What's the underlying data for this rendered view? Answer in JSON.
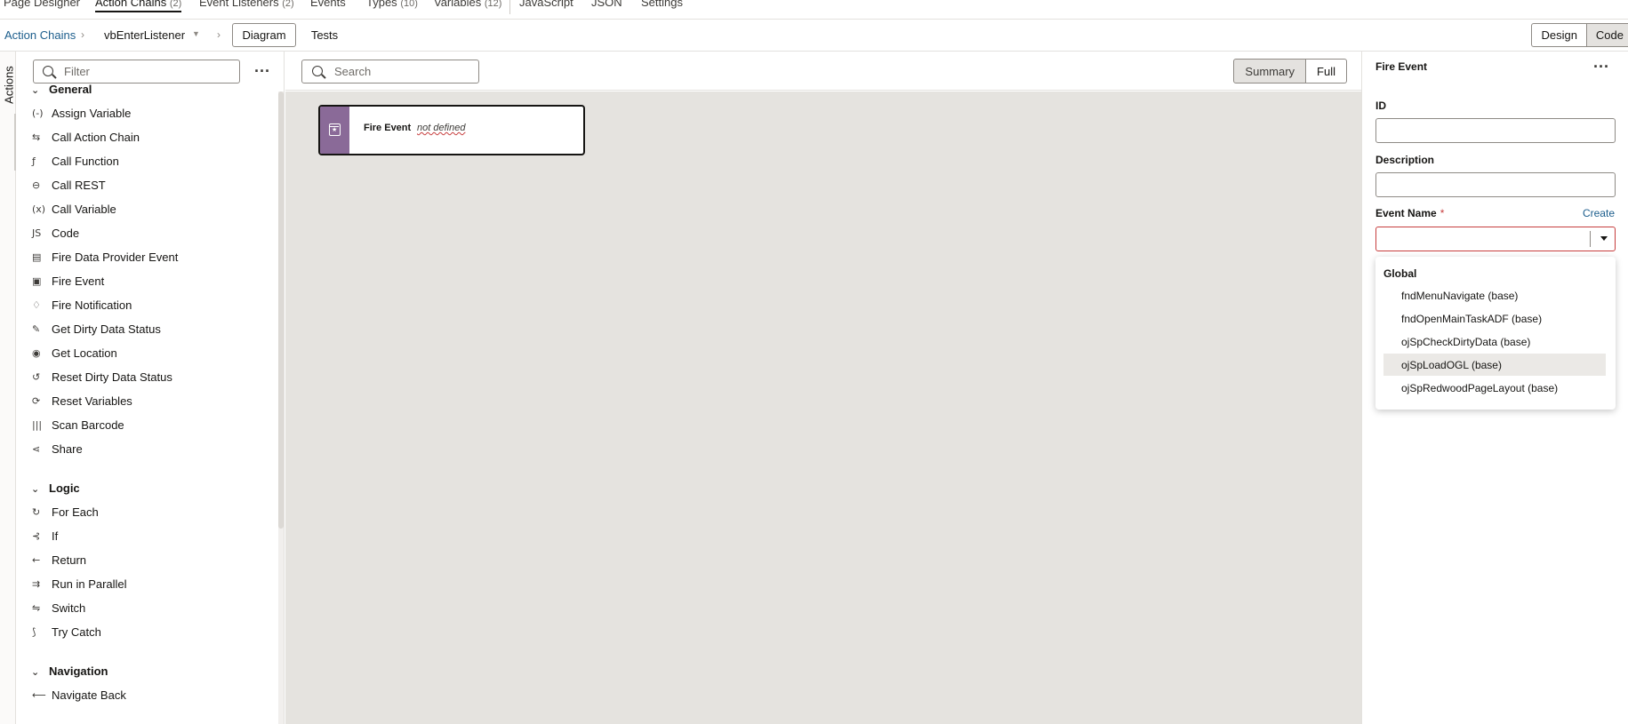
{
  "top_tabs": [
    {
      "label": "Page Designer",
      "count": ""
    },
    {
      "label": "Action Chains",
      "count": "(2)"
    },
    {
      "label": "Event Listeners",
      "count": "(2)"
    },
    {
      "label": "Events",
      "count": ""
    },
    {
      "label": "Types",
      "count": "(10)"
    },
    {
      "label": "Variables",
      "count": "(12)"
    },
    {
      "label": "JavaScript",
      "count": ""
    },
    {
      "label": "JSON",
      "count": ""
    },
    {
      "label": "Settings",
      "count": ""
    }
  ],
  "breadcrumb": {
    "root": "Action Chains",
    "current": "vbEnterListener",
    "diagram": "Diagram",
    "tests": "Tests"
  },
  "mode_toggle": {
    "design": "Design",
    "code": "Code"
  },
  "side_tab": "Actions",
  "palette": {
    "filter_placeholder": "Filter",
    "sections": [
      {
        "title": "General",
        "items": [
          {
            "label": "Assign Variable",
            "icon": "(-)"
          },
          {
            "label": "Call Action Chain",
            "icon": "⇆"
          },
          {
            "label": "Call Function",
            "icon": "ƒ"
          },
          {
            "label": "Call REST",
            "icon": "⊖"
          },
          {
            "label": "Call Variable",
            "icon": "(x)"
          },
          {
            "label": "Code",
            "icon": "JS"
          },
          {
            "label": "Fire Data Provider Event",
            "icon": "▤"
          },
          {
            "label": "Fire Event",
            "icon": "▣"
          },
          {
            "label": "Fire Notification",
            "icon": "♢"
          },
          {
            "label": "Get Dirty Data Status",
            "icon": "✎"
          },
          {
            "label": "Get Location",
            "icon": "◉"
          },
          {
            "label": "Reset Dirty Data Status",
            "icon": "↺"
          },
          {
            "label": "Reset Variables",
            "icon": "⟳"
          },
          {
            "label": "Scan Barcode",
            "icon": "|||"
          },
          {
            "label": "Share",
            "icon": "⋖"
          }
        ]
      },
      {
        "title": "Logic",
        "items": [
          {
            "label": "For Each",
            "icon": "↻"
          },
          {
            "label": "If",
            "icon": "⊰"
          },
          {
            "label": "Return",
            "icon": "←"
          },
          {
            "label": "Run in Parallel",
            "icon": "⇉"
          },
          {
            "label": "Switch",
            "icon": "⇋"
          },
          {
            "label": "Try Catch",
            "icon": "⟆"
          }
        ]
      },
      {
        "title": "Navigation",
        "items": [
          {
            "label": "Navigate Back",
            "icon": "⟵"
          }
        ]
      }
    ]
  },
  "canvas": {
    "search_placeholder": "Search",
    "view_summary": "Summary",
    "view_full": "Full",
    "node": {
      "title": "Fire Event",
      "subtitle": "not defined"
    }
  },
  "properties": {
    "title": "Fire Event",
    "id_label": "ID",
    "id_value": "",
    "description_label": "Description",
    "description_value": "",
    "event_name_label": "Event Name",
    "required_mark": "*",
    "create_link": "Create",
    "dropdown": {
      "group": "Global",
      "options": [
        "fndMenuNavigate (base)",
        "fndOpenMainTaskADF (base)",
        "ojSpCheckDirtyData (base)",
        "ojSpLoadOGL (base)",
        "ojSpRedwoodPageLayout (base)"
      ],
      "highlighted_index": 3
    }
  }
}
